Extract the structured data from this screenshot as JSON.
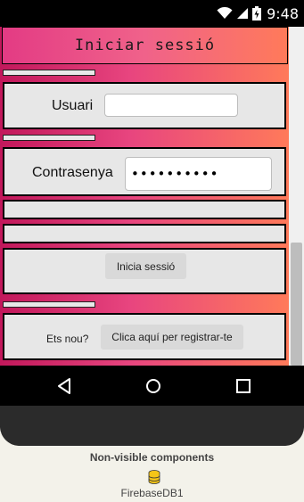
{
  "status_bar": {
    "time": "9:48"
  },
  "form": {
    "title": "Iniciar sessió",
    "username_label": "Usuari",
    "username_value": "",
    "password_label": "Contrasenya",
    "password_value": "••••••••••",
    "login_button": "Inicia sessió",
    "new_user_label": "Ets nou?",
    "register_button": "Clica aquí per registrar-te"
  },
  "non_visible": {
    "title": "Non-visible components",
    "components": [
      {
        "label": "FirebaseDB1",
        "icon": "database-icon"
      }
    ]
  },
  "colors": {
    "gradient_start": "#c2185b",
    "gradient_mid": "#e8457f",
    "gradient_end": "#ff7a5a",
    "panel": "#e7e7e7"
  }
}
